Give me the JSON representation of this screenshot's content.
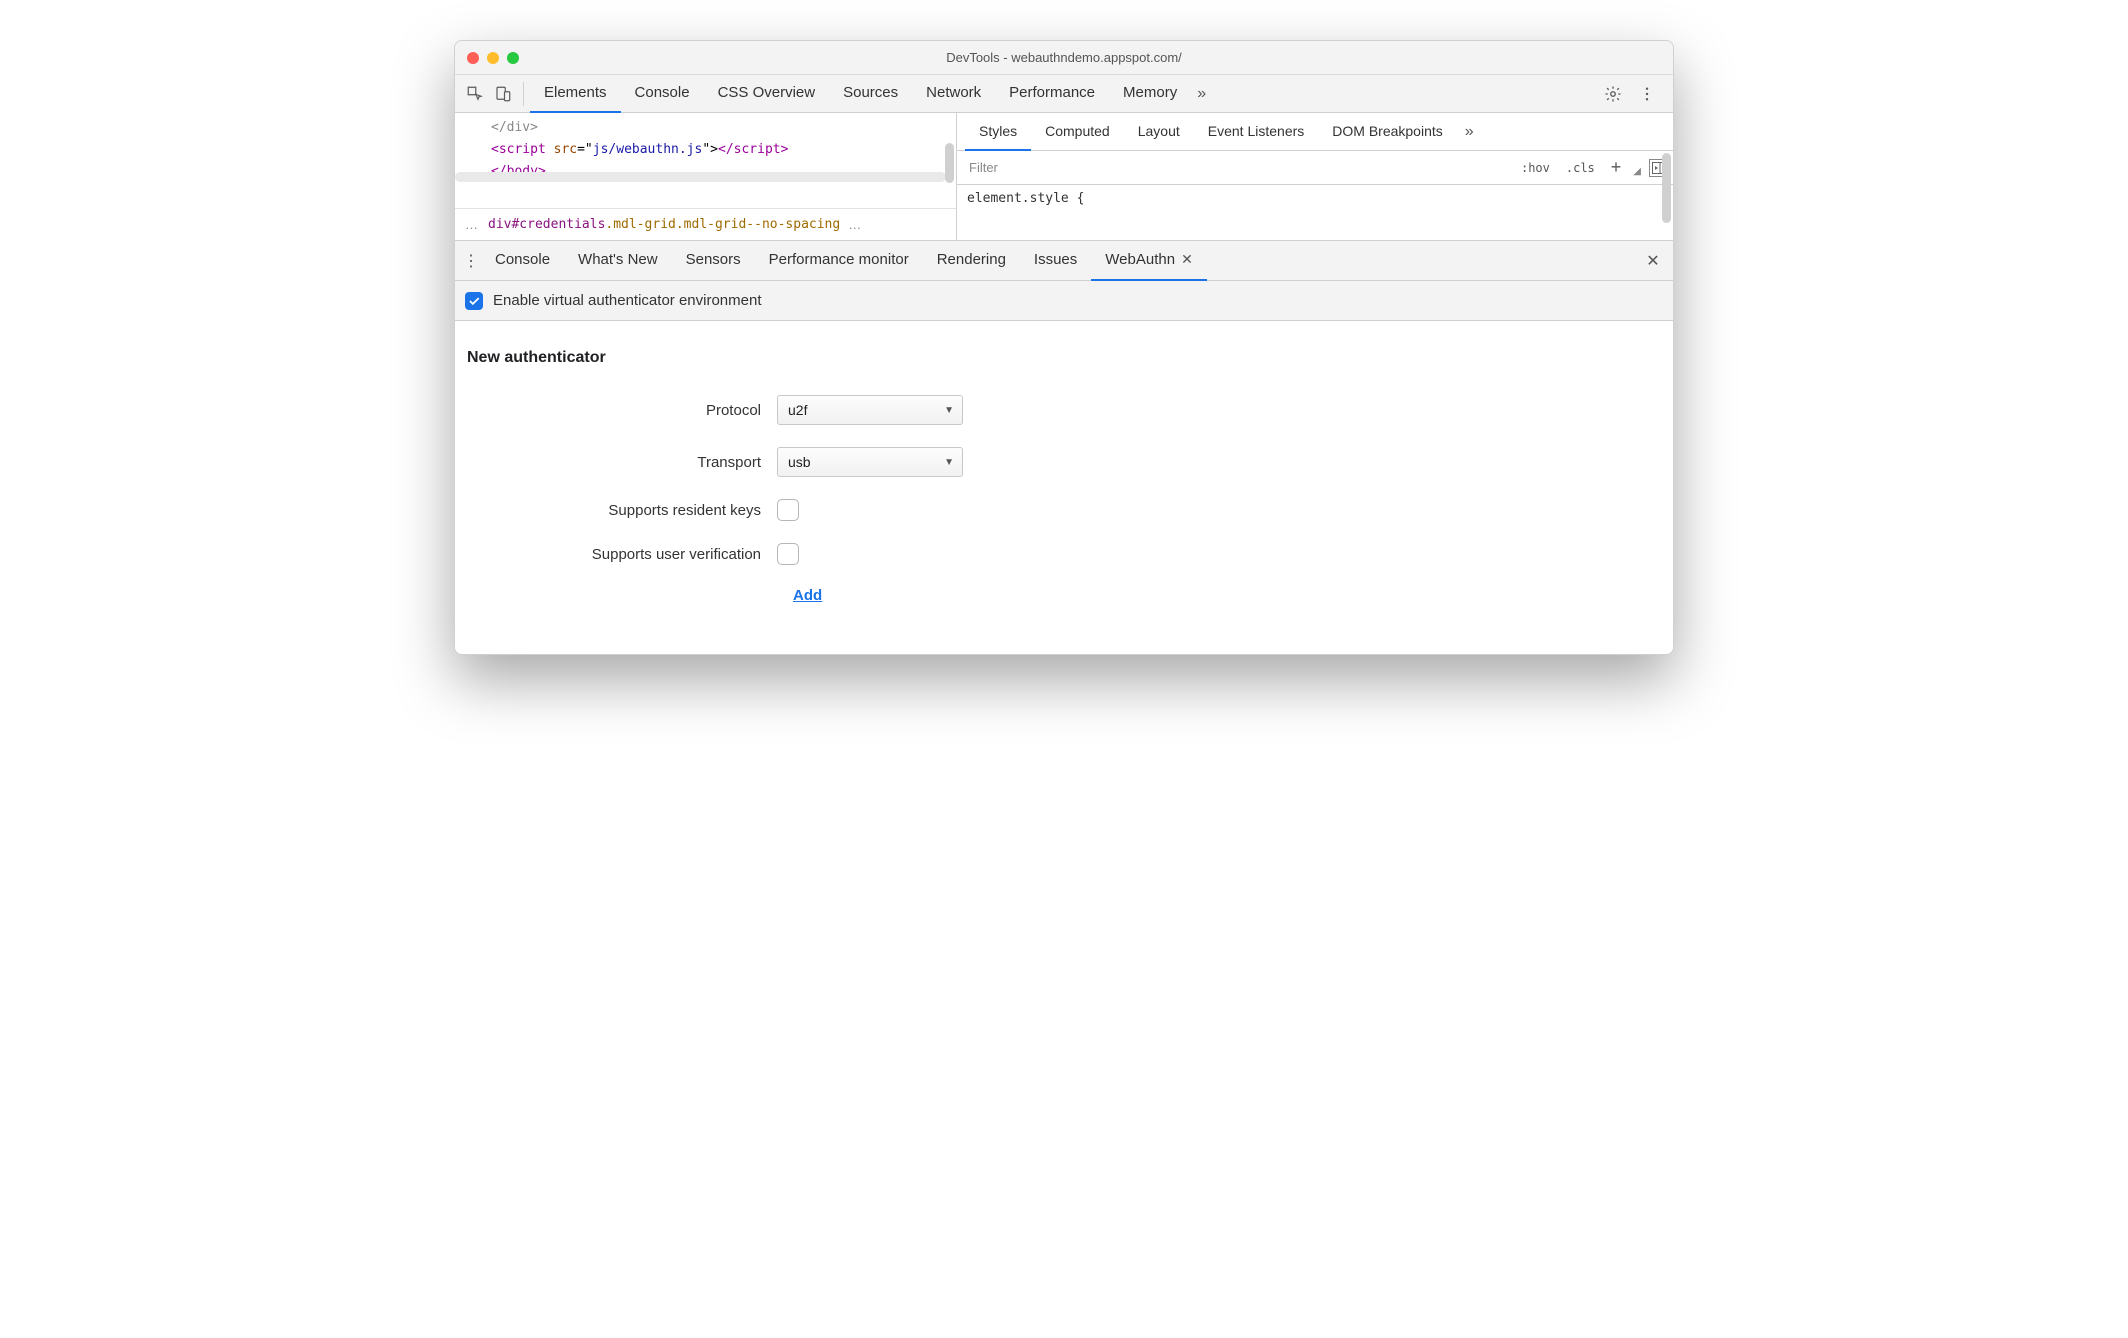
{
  "window": {
    "title": "DevTools - webauthndemo.appspot.com/"
  },
  "main_tabs": {
    "items": [
      {
        "label": "Elements"
      },
      {
        "label": "Console"
      },
      {
        "label": "CSS Overview"
      },
      {
        "label": "Sources"
      },
      {
        "label": "Network"
      },
      {
        "label": "Performance"
      },
      {
        "label": "Memory"
      }
    ]
  },
  "dom": {
    "line1": "</div>",
    "script_open": "<script ",
    "attr_name": "src",
    "attr_eq": "=\"",
    "attr_val": "js/webauthn.js",
    "attr_close": "\">",
    "script_close_tag": "</scr",
    "script_close_tag2": "ipt>",
    "line3": "</body>"
  },
  "breadcrumb": {
    "ell1": "…",
    "tag": "div",
    "hashid": "#credentials",
    "classes": ".mdl-grid.mdl-grid--no-spacing",
    "ell2": "…"
  },
  "styles_tabs": {
    "items": [
      {
        "label": "Styles"
      },
      {
        "label": "Computed"
      },
      {
        "label": "Layout"
      },
      {
        "label": "Event Listeners"
      },
      {
        "label": "DOM Breakpoints"
      }
    ]
  },
  "filter": {
    "placeholder": "Filter",
    "hov": ":hov",
    "cls": ".cls"
  },
  "style_body": {
    "text": "element.style {"
  },
  "drawer_tabs": {
    "items": [
      {
        "label": "Console"
      },
      {
        "label": "What's New"
      },
      {
        "label": "Sensors"
      },
      {
        "label": "Performance monitor"
      },
      {
        "label": "Rendering"
      },
      {
        "label": "Issues"
      },
      {
        "label": "WebAuthn"
      }
    ]
  },
  "enable": {
    "label": "Enable virtual authenticator environment"
  },
  "panel": {
    "heading": "New authenticator",
    "rows": {
      "protocol": {
        "label": "Protocol",
        "value": "u2f"
      },
      "transport": {
        "label": "Transport",
        "value": "usb"
      },
      "resident": {
        "label": "Supports resident keys"
      },
      "userver": {
        "label": "Supports user verification"
      }
    },
    "add": "Add"
  }
}
